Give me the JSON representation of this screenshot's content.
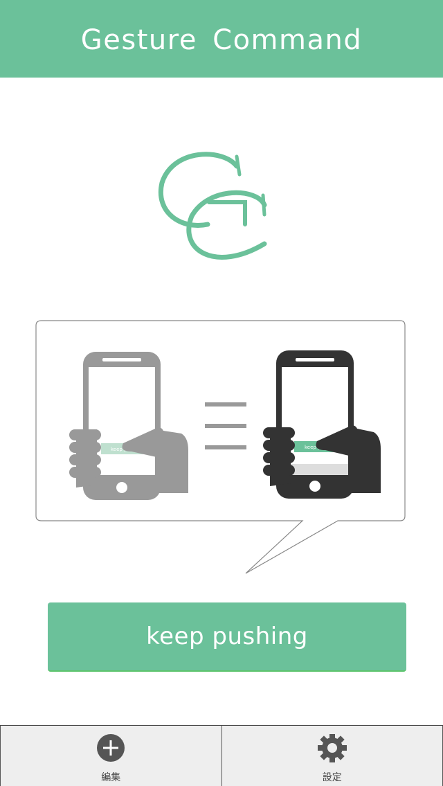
{
  "header": {
    "title": "Gesture Command"
  },
  "logo": {
    "letters": "GC",
    "color": "#6bc19a"
  },
  "illustration": {
    "left_phone_button_text": "keep pushing",
    "right_phone_button_text": "keep pushing",
    "left_phone_color": "#999999",
    "right_phone_color": "#333333",
    "equals_color": "#999999"
  },
  "action_button": {
    "label": "keep pushing",
    "color": "#6bc19a"
  },
  "tabbar": {
    "tabs": [
      {
        "label": "編集",
        "icon": "plus-circle-icon"
      },
      {
        "label": "設定",
        "icon": "gear-icon"
      }
    ]
  },
  "colors": {
    "accent": "#6bc19a",
    "tabbar_bg": "#eeeeee",
    "icon_dark": "#555555"
  }
}
